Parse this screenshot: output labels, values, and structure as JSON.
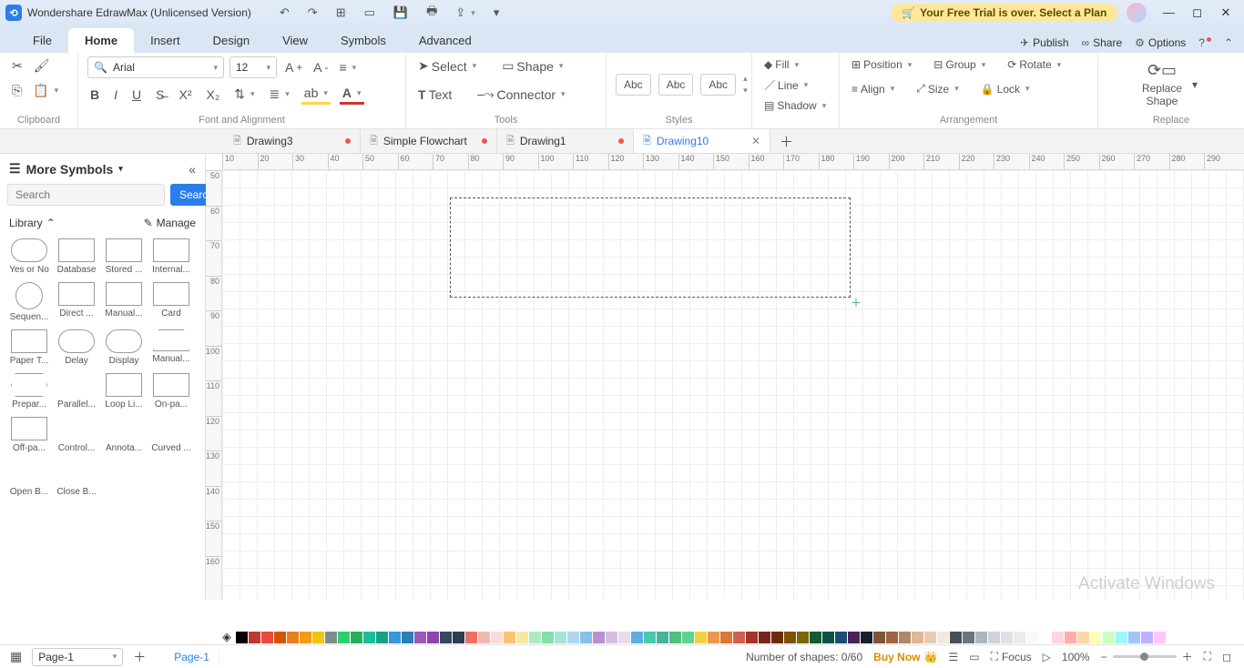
{
  "titlebar": {
    "app_title": "Wondershare EdrawMax (Unlicensed Version)"
  },
  "trial": {
    "text": "Your Free Trial is over. Select a Plan"
  },
  "menu": {
    "tabs": [
      "File",
      "Home",
      "Insert",
      "Design",
      "View",
      "Symbols",
      "Advanced"
    ],
    "active": 1,
    "publish": "Publish",
    "share": "Share",
    "options": "Options"
  },
  "ribbon": {
    "clipboard": "Clipboard",
    "font_name": "Arial",
    "font_size": "12",
    "font_align": "Font and Alignment",
    "select": "Select",
    "shape": "Shape",
    "text": "Text",
    "connector": "Connector",
    "tools": "Tools",
    "abc": "Abc",
    "styles": "Styles",
    "fill": "Fill",
    "line": "Line",
    "shadow": "Shadow",
    "position": "Position",
    "align": "Align",
    "group": "Group",
    "size": "Size",
    "rotate": "Rotate",
    "lock": "Lock",
    "arrangement": "Arrangement",
    "replace_shape": "Replace\nShape",
    "replace": "Replace"
  },
  "doctabs": {
    "items": [
      {
        "label": "Drawing3",
        "dirty": true,
        "active": false
      },
      {
        "label": "Simple Flowchart",
        "dirty": true,
        "active": false
      },
      {
        "label": "Drawing1",
        "dirty": true,
        "active": false
      },
      {
        "label": "Drawing10",
        "dirty": false,
        "active": true
      }
    ]
  },
  "left": {
    "more": "More Symbols",
    "search_ph": "Search",
    "search_btn": "Search",
    "library": "Library",
    "manage": "Manage",
    "shapes": [
      [
        "Yes or No",
        "Database",
        "Stored ...",
        "Internal..."
      ],
      [
        "Sequen...",
        "Direct ...",
        "Manual...",
        "Card"
      ],
      [
        "Paper T...",
        "Delay",
        "Display",
        "Manual..."
      ],
      [
        "Prepar...",
        "Parallel...",
        "Loop Li...",
        "On-pa..."
      ],
      [
        "Off-pa...",
        "Control...",
        "Annota...",
        "Curved ..."
      ],
      [
        "Open B...",
        "Close B...",
        "",
        ""
      ]
    ]
  },
  "ruler_h": [
    "10",
    "20",
    "30",
    "40",
    "50",
    "60",
    "70",
    "80",
    "90",
    "100",
    "110",
    "120",
    "130",
    "140",
    "150",
    "160",
    "170",
    "180",
    "190",
    "200",
    "210",
    "220",
    "230",
    "240",
    "250",
    "260",
    "270",
    "280",
    "290"
  ],
  "ruler_v": [
    "50",
    "60",
    "70",
    "80",
    "90",
    "100",
    "110",
    "120",
    "130",
    "140",
    "150",
    "160"
  ],
  "watermark": "Activate Windows",
  "status": {
    "page": "Page-1",
    "pagetab": "Page-1",
    "shapes": "Number of shapes: 0/60",
    "buy": "Buy Now",
    "focus": "Focus",
    "zoom": "100%"
  },
  "palette": [
    "#000",
    "#c0392b",
    "#e74c3c",
    "#d35400",
    "#e67e22",
    "#f39c12",
    "#f1c40f",
    "#7f8c8d",
    "#2ecc71",
    "#27ae60",
    "#1abc9c",
    "#16a085",
    "#3498db",
    "#2980b9",
    "#9b59b6",
    "#8e44ad",
    "#34495e",
    "#2c3e50",
    "#ec7063",
    "#f5b7b1",
    "#fadbd8",
    "#f8c471",
    "#f9e79f",
    "#abebc6",
    "#82e0aa",
    "#a3e4d7",
    "#aed6f1",
    "#85c1e9",
    "#bb8fce",
    "#d7bde2",
    "#e8daef",
    "#5dade2",
    "#48c9b0",
    "#45b39d",
    "#52be80",
    "#58d68d",
    "#f4d03f",
    "#eb984e",
    "#dc7633",
    "#cd6155",
    "#a93226",
    "#7b241c",
    "#6e2c00",
    "#7e5109",
    "#7d6608",
    "#145a32",
    "#0b5345",
    "#1b4f72",
    "#4a235a",
    "#17202a",
    "#7f5539",
    "#9c6644",
    "#b08968",
    "#ddb892",
    "#e6ccb2",
    "#f3e9dc",
    "#495057",
    "#6c757d",
    "#adb5bd",
    "#ced4da",
    "#dee2e6",
    "#e9ecef",
    "#f8f9fa",
    "#fff",
    "#ffd6e0",
    "#ffadad",
    "#ffd6a5",
    "#fdffb6",
    "#caffbf",
    "#9bf6ff",
    "#a0c4ff",
    "#bdb2ff",
    "#ffc6ff"
  ]
}
